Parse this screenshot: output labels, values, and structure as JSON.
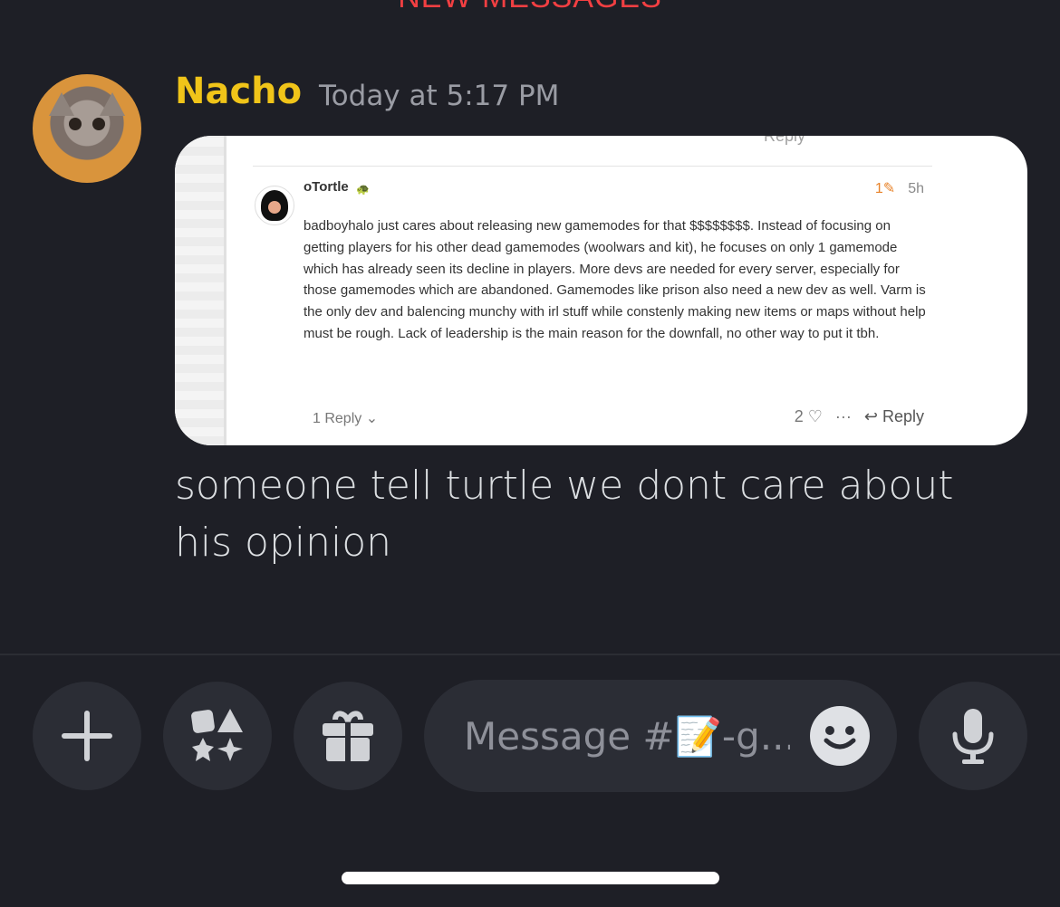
{
  "banner": {
    "new_messages": "NEW MESSAGES"
  },
  "message": {
    "author": "Nacho",
    "timestamp": "Today at 5:17 PM",
    "text": "someone tell turtle we dont care about his opinion",
    "attachment": {
      "cut_off_top": "Reply",
      "post_author": "oTortle",
      "edit_count": "1",
      "age": "5h",
      "body": "badboyhalo just cares about releasing new gamemodes for that $$$$$$$$. Instead of focusing on getting players for his other dead gamemodes (woolwars and kit), he focuses on only 1 gamemode which has already seen its decline in players. More devs are needed for every server, especially for those gamemodes which are abandoned. Gamemodes like prison also need a new dev as well. Varm is the only dev and balencing munchy with irl stuff while constenly making new items or maps without help must be rough. Lack of leadership is the main reason for the downfall, no other way to put it tbh.",
      "replies_toggle": "1 Reply",
      "likes": "2",
      "more": "···",
      "reply_label": "Reply"
    }
  },
  "composer": {
    "placeholder": "Message #📝-g..."
  },
  "icons": {
    "add": "plus-icon",
    "apps": "apps-icon",
    "gift": "gift-icon",
    "emoji": "emoji-icon",
    "mic": "microphone-icon"
  },
  "colors": {
    "background": "#1e1f26",
    "username": "#f0c419",
    "new_messages": "#f23f42",
    "button_bg": "#2b2d35"
  }
}
